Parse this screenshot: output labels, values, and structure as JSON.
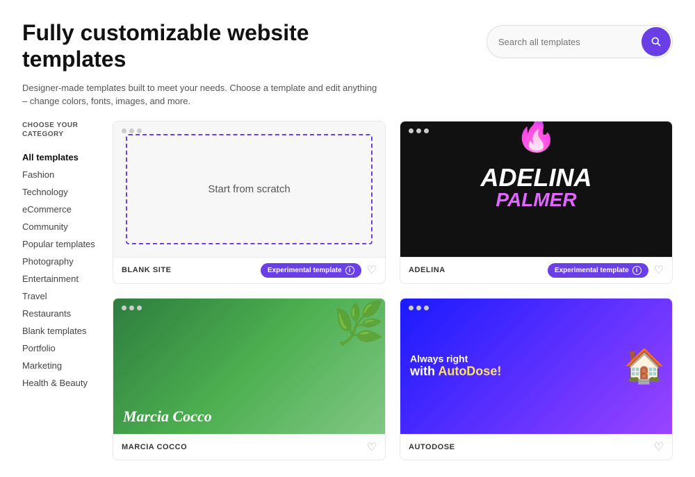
{
  "header": {
    "title": "Fully customizable website templates",
    "subtitle": "Designer-made templates built to meet your needs. Choose a template and edit anything – change colors, fonts, images, and more.",
    "search": {
      "placeholder": "Search all templates",
      "button_label": "Search"
    }
  },
  "sidebar": {
    "category_label": "CHOOSE YOUR CATEGORY",
    "items": [
      {
        "id": "all-templates",
        "label": "All templates",
        "active": true
      },
      {
        "id": "fashion",
        "label": "Fashion",
        "active": false
      },
      {
        "id": "technology",
        "label": "Technology",
        "active": false
      },
      {
        "id": "ecommerce",
        "label": "eCommerce",
        "active": false
      },
      {
        "id": "community",
        "label": "Community",
        "active": false
      },
      {
        "id": "popular-templates",
        "label": "Popular templates",
        "active": false
      },
      {
        "id": "photography",
        "label": "Photography",
        "active": false
      },
      {
        "id": "entertainment",
        "label": "Entertainment",
        "active": false
      },
      {
        "id": "travel",
        "label": "Travel",
        "active": false
      },
      {
        "id": "restaurants",
        "label": "Restaurants",
        "active": false
      },
      {
        "id": "blank-templates",
        "label": "Blank templates",
        "active": false
      },
      {
        "id": "portfolio",
        "label": "Portfolio",
        "active": false
      },
      {
        "id": "marketing",
        "label": "Marketing",
        "active": false
      },
      {
        "id": "health-beauty",
        "label": "Health & Beauty",
        "active": false
      }
    ]
  },
  "templates": [
    {
      "id": "blank-site",
      "name": "BLANK SITE",
      "badge": "Experimental template",
      "type": "blank",
      "center_text": "Start from scratch"
    },
    {
      "id": "adelina",
      "name": "ADELINA",
      "badge": "Experimental template",
      "type": "adelina",
      "title_line1": "ADELINA",
      "title_line2": "Palmer"
    },
    {
      "id": "marcia-cocco",
      "name": "MARCIA COCCO",
      "badge": null,
      "type": "marcia",
      "artist_name": "Marcia Cocco"
    },
    {
      "id": "autodose",
      "name": "AUTODOSE",
      "badge": null,
      "type": "autodose",
      "line1": "Always right",
      "line2": "with AutoDose!"
    }
  ],
  "colors": {
    "accent": "#6b3fe6",
    "accent_light": "#e066ff"
  }
}
